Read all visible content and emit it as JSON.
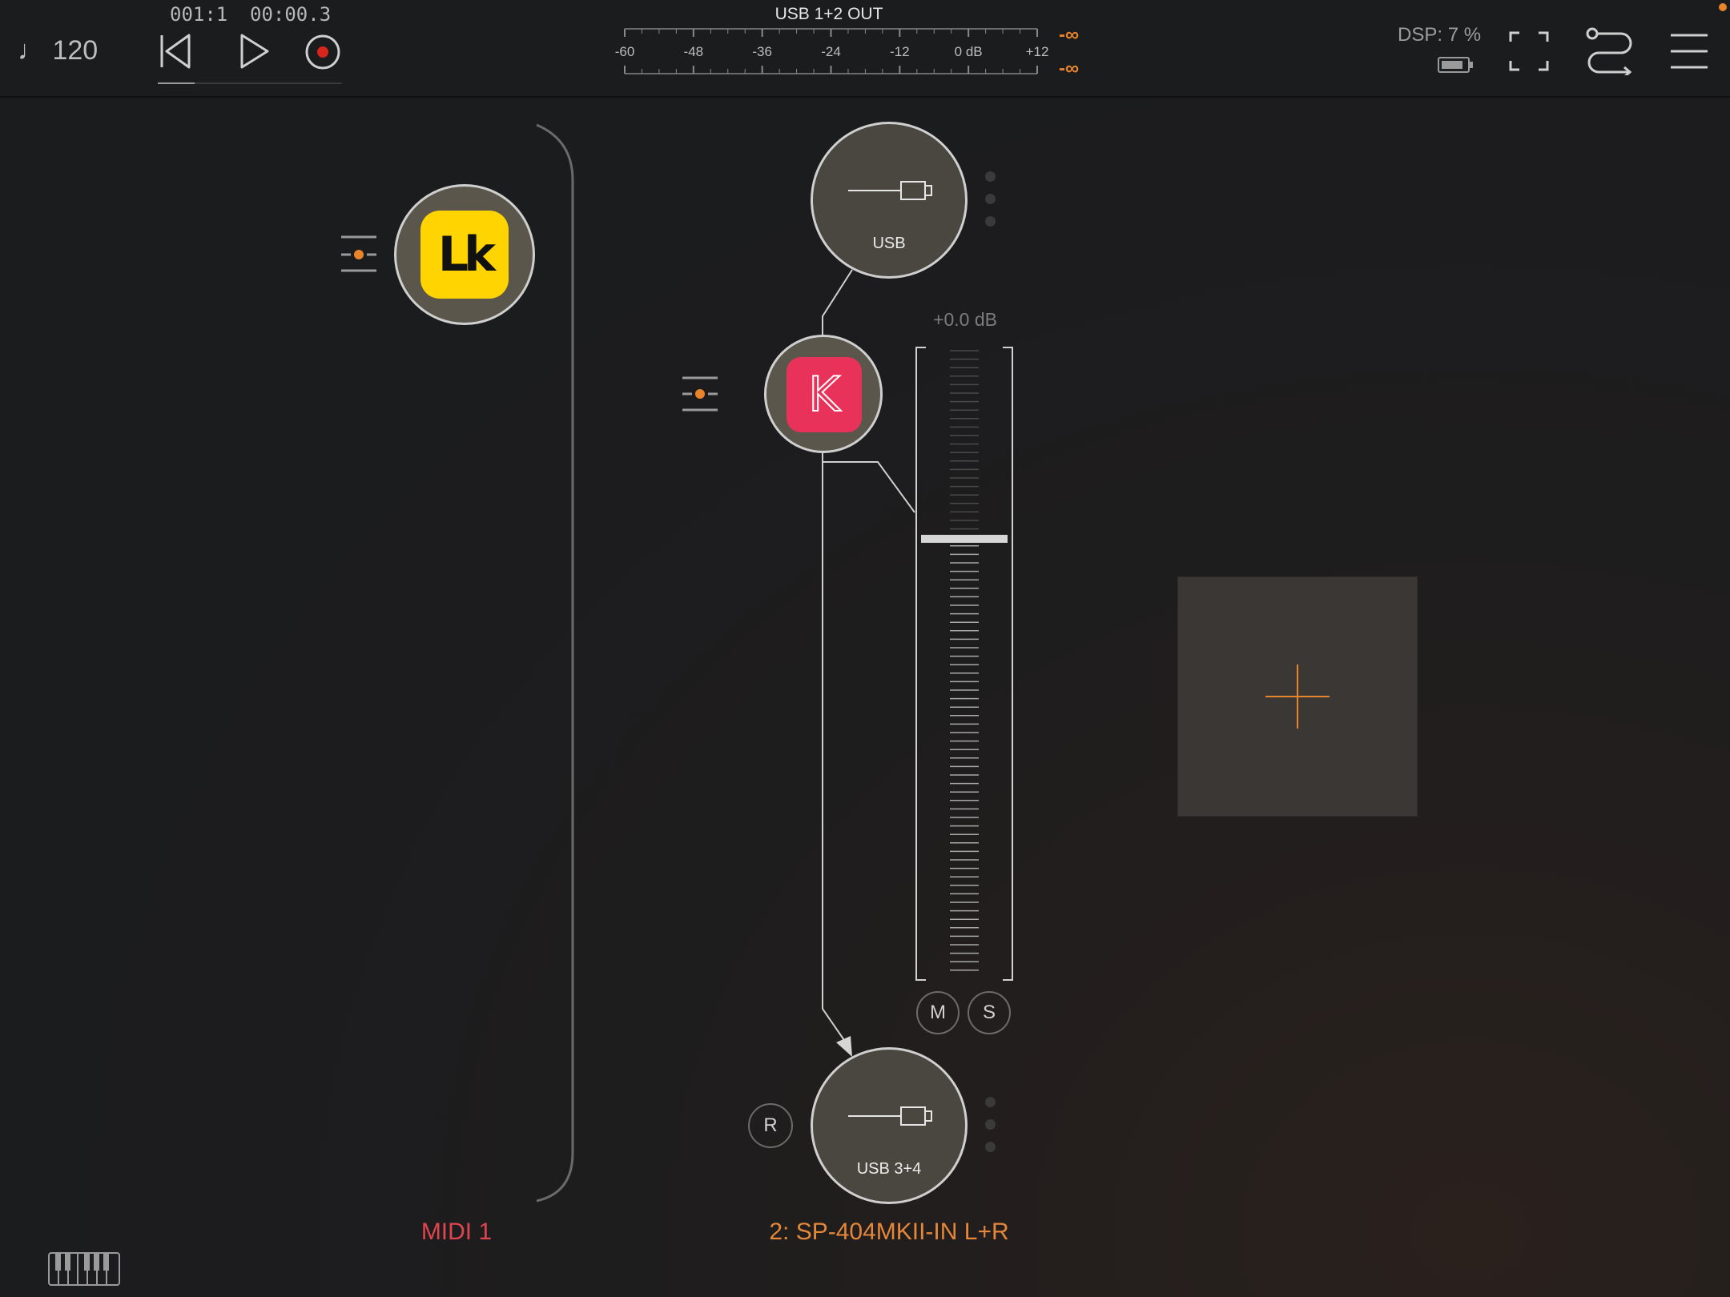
{
  "transport": {
    "tempo": "120",
    "position_bars": "001:1",
    "position_time": "00:00.3",
    "progress": 0.2
  },
  "meter": {
    "title": "USB 1+2 OUT",
    "scale_labels": [
      "-60",
      "-48",
      "-36",
      "-24",
      "-12",
      "0 dB",
      "+12"
    ],
    "peak_left": "-∞",
    "peak_right": "-∞"
  },
  "status": {
    "dsp_label": "DSP:",
    "dsp_value": "7 %"
  },
  "channels": [
    {
      "name": "MIDI 1",
      "color": "#e0454f",
      "plugin_icon_text": "Lk",
      "plugin_color": "#ffd400"
    },
    {
      "name": "2: SP-404MKII-IN L+R",
      "color": "#e5873a",
      "input_label": "USB",
      "plugin_icon_text": "K",
      "plugin_color": "#e8325a",
      "gain": "+0.0 dB",
      "fader_level_db": 0,
      "mute_label": "M",
      "solo_label": "S",
      "record_label": "R",
      "output_label": "USB 3+4"
    }
  ],
  "colors": {
    "accent": "#e8842c",
    "record": "#d8261c",
    "background": "#1d1e20"
  },
  "icons": {
    "tempo": "note-icon",
    "rewind": "rewind-icon",
    "play": "play-icon",
    "record": "record-icon",
    "battery": "battery-icon",
    "fullscreen": "fullscreen-icon",
    "routing": "routing-icon",
    "menu": "menu-icon",
    "keyboard": "keyboard-icon",
    "add": "add-icon"
  }
}
